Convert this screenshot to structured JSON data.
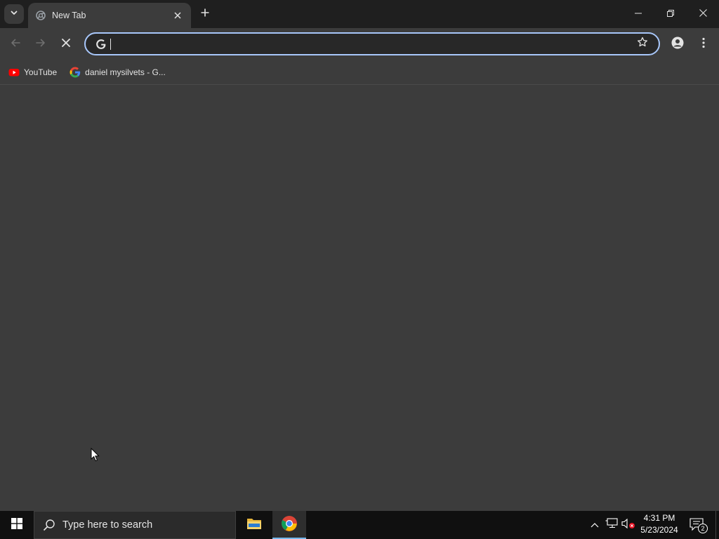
{
  "tabstrip": {
    "tab_search_icon": "chevron-down-icon",
    "active_tab": {
      "title": "New Tab",
      "icon": "chrome-loading-icon",
      "close_icon": "close-icon"
    },
    "new_tab_icon": "plus-icon",
    "window_controls": [
      "minimize-icon",
      "restore-icon",
      "close-icon"
    ]
  },
  "toolbar": {
    "back_icon": "back-arrow-icon",
    "forward_icon": "forward-arrow-icon",
    "stop_icon": "stop-loading-icon",
    "omnibox": {
      "value": "",
      "placeholder": "",
      "left_icon": "google-g-icon",
      "right_icon": "bookmark-star-icon"
    },
    "profile_icon": "profile-icon",
    "menu_icon": "kebab-menu-icon"
  },
  "bookmarks": [
    {
      "label": "YouTube",
      "icon": "youtube-icon"
    },
    {
      "label": "daniel mysilvets - G...",
      "icon": "google-g-icon"
    }
  ],
  "taskbar": {
    "search_placeholder": "Type here to search",
    "apps": [
      {
        "name": "File Explorer",
        "icon": "folder-icon",
        "active": false
      },
      {
        "name": "Google Chrome",
        "icon": "chrome-icon",
        "active": true
      }
    ],
    "tray": {
      "time": "4:31 PM",
      "date": "5/23/2024",
      "notification_count": "2"
    }
  },
  "colors": {
    "frame": "#1f1f1f",
    "toolbar": "#3c3c3c",
    "omnibox_border": "#a8c7fa",
    "taskbar": "#101010",
    "youtube_red": "#ff0000",
    "chrome_active_underline": "#76b9ed"
  }
}
